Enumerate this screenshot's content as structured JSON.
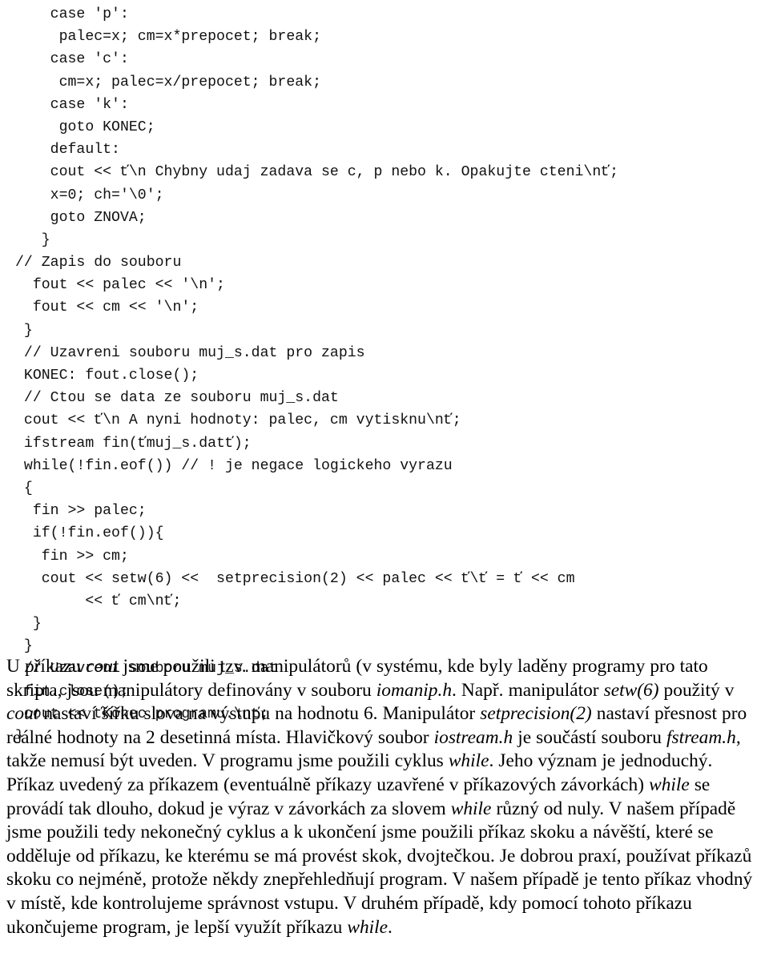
{
  "document": {
    "language": "cs",
    "background_color": "#ffffff",
    "text_color": "#000000"
  },
  "code_listing": {
    "name": "cpp-code-listing",
    "lines": [
      "    case 'p':",
      "     palec=x; cm=x*prepocet; break;",
      "    case 'c':",
      "     cm=x; palec=x/prepocet; break;",
      "    case 'k':",
      "     goto KONEC;",
      "    default:",
      "    cout << ť\\n Chybny udaj zadava se c, p nebo k. Opakujte cteni\\nť;",
      "    x=0; ch='\\0';",
      "    goto ZNOVA;",
      "   }",
      "// Zapis do souboru",
      "  fout << palec << '\\n';",
      "  fout << cm << '\\n';",
      " }",
      " // Uzavreni souboru muj_s.dat pro zapis",
      " KONEC: fout.close();",
      " // Ctou se data ze souboru muj_s.dat",
      " cout << ť\\n A nyni hodnoty: palec, cm vytisknu\\nť;",
      " ifstream fin(ťmuj_s.datť);",
      " while(!fin.eof()) // ! je negace logickeho vyrazu",
      " {",
      "  fin >> palec;",
      "  if(!fin.eof()){",
      "   fin >> cm;",
      "   cout << setw(6) <<  setprecision(2) << palec << ť\\ť = ť << cm",
      "        << ť cm\\nť;",
      "  }",
      " }",
      " // Uzavreni souboru muj_s.dat",
      " fin.close();",
      " cout << ťKonec programu.\\nť;",
      "}"
    ]
  },
  "prose": {
    "name": "explanatory-paragraph",
    "segments": [
      {
        "text": "U příkazu ",
        "style": "normal"
      },
      {
        "text": "cout",
        "style": "italic"
      },
      {
        "text": " jsme použili tzv. manipulátorů (v systému, kde byly laděny programy pro tato skripta, jsou manipulátory definovány v souboru ",
        "style": "normal"
      },
      {
        "text": "iomanip.h",
        "style": "italic"
      },
      {
        "text": ". Např. manipulátor ",
        "style": "normal"
      },
      {
        "text": "setw(6)",
        "style": "italic"
      },
      {
        "text": " použitý v ",
        "style": "normal"
      },
      {
        "text": "cout",
        "style": "italic"
      },
      {
        "text": " nastaví šířku slova na výstupu na hodnotu 6. Manipulátor ",
        "style": "normal"
      },
      {
        "text": "setprecision(2)",
        "style": "italic"
      },
      {
        "text": " nastaví přesnost pro reálné hodnoty na 2 desetinná místa. Hlavičkový soubor ",
        "style": "normal"
      },
      {
        "text": "iostream.h",
        "style": "italic"
      },
      {
        "text": " je součástí souboru ",
        "style": "normal"
      },
      {
        "text": "fstream.h",
        "style": "italic"
      },
      {
        "text": ", takže nemusí být uveden. V programu jsme použili cyklus ",
        "style": "normal"
      },
      {
        "text": "while",
        "style": "italic"
      },
      {
        "text": ". Jeho význam je jednoduchý. Příkaz uvedený za příkazem (eventuálně příkazy uzavřené v příkazových závorkách) ",
        "style": "normal"
      },
      {
        "text": "while",
        "style": "italic"
      },
      {
        "text": " se provádí tak dlouho, dokud je výraz v závorkách za slovem ",
        "style": "normal"
      },
      {
        "text": "while",
        "style": "italic"
      },
      {
        "text": " různý od nuly. V našem případě jsme použili tedy nekonečný cyklus a k ukončení jsme použili příkaz skoku a návěští, které se odděluje od příkazu, ke kterému se má provést skok, dvojtečkou. Je dobrou praxí, používat příkazů skoku co nejméně, protože někdy znepřehledňují program. V našem případě je tento příkaz vhodný v místě, kde kontrolujeme správnost vstupu. V druhém případě, kdy pomocí tohoto příkazu ukončujeme program, je lepší využít příkazu ",
        "style": "normal"
      },
      {
        "text": "while",
        "style": "italic"
      },
      {
        "text": ".",
        "style": "normal"
      }
    ]
  }
}
